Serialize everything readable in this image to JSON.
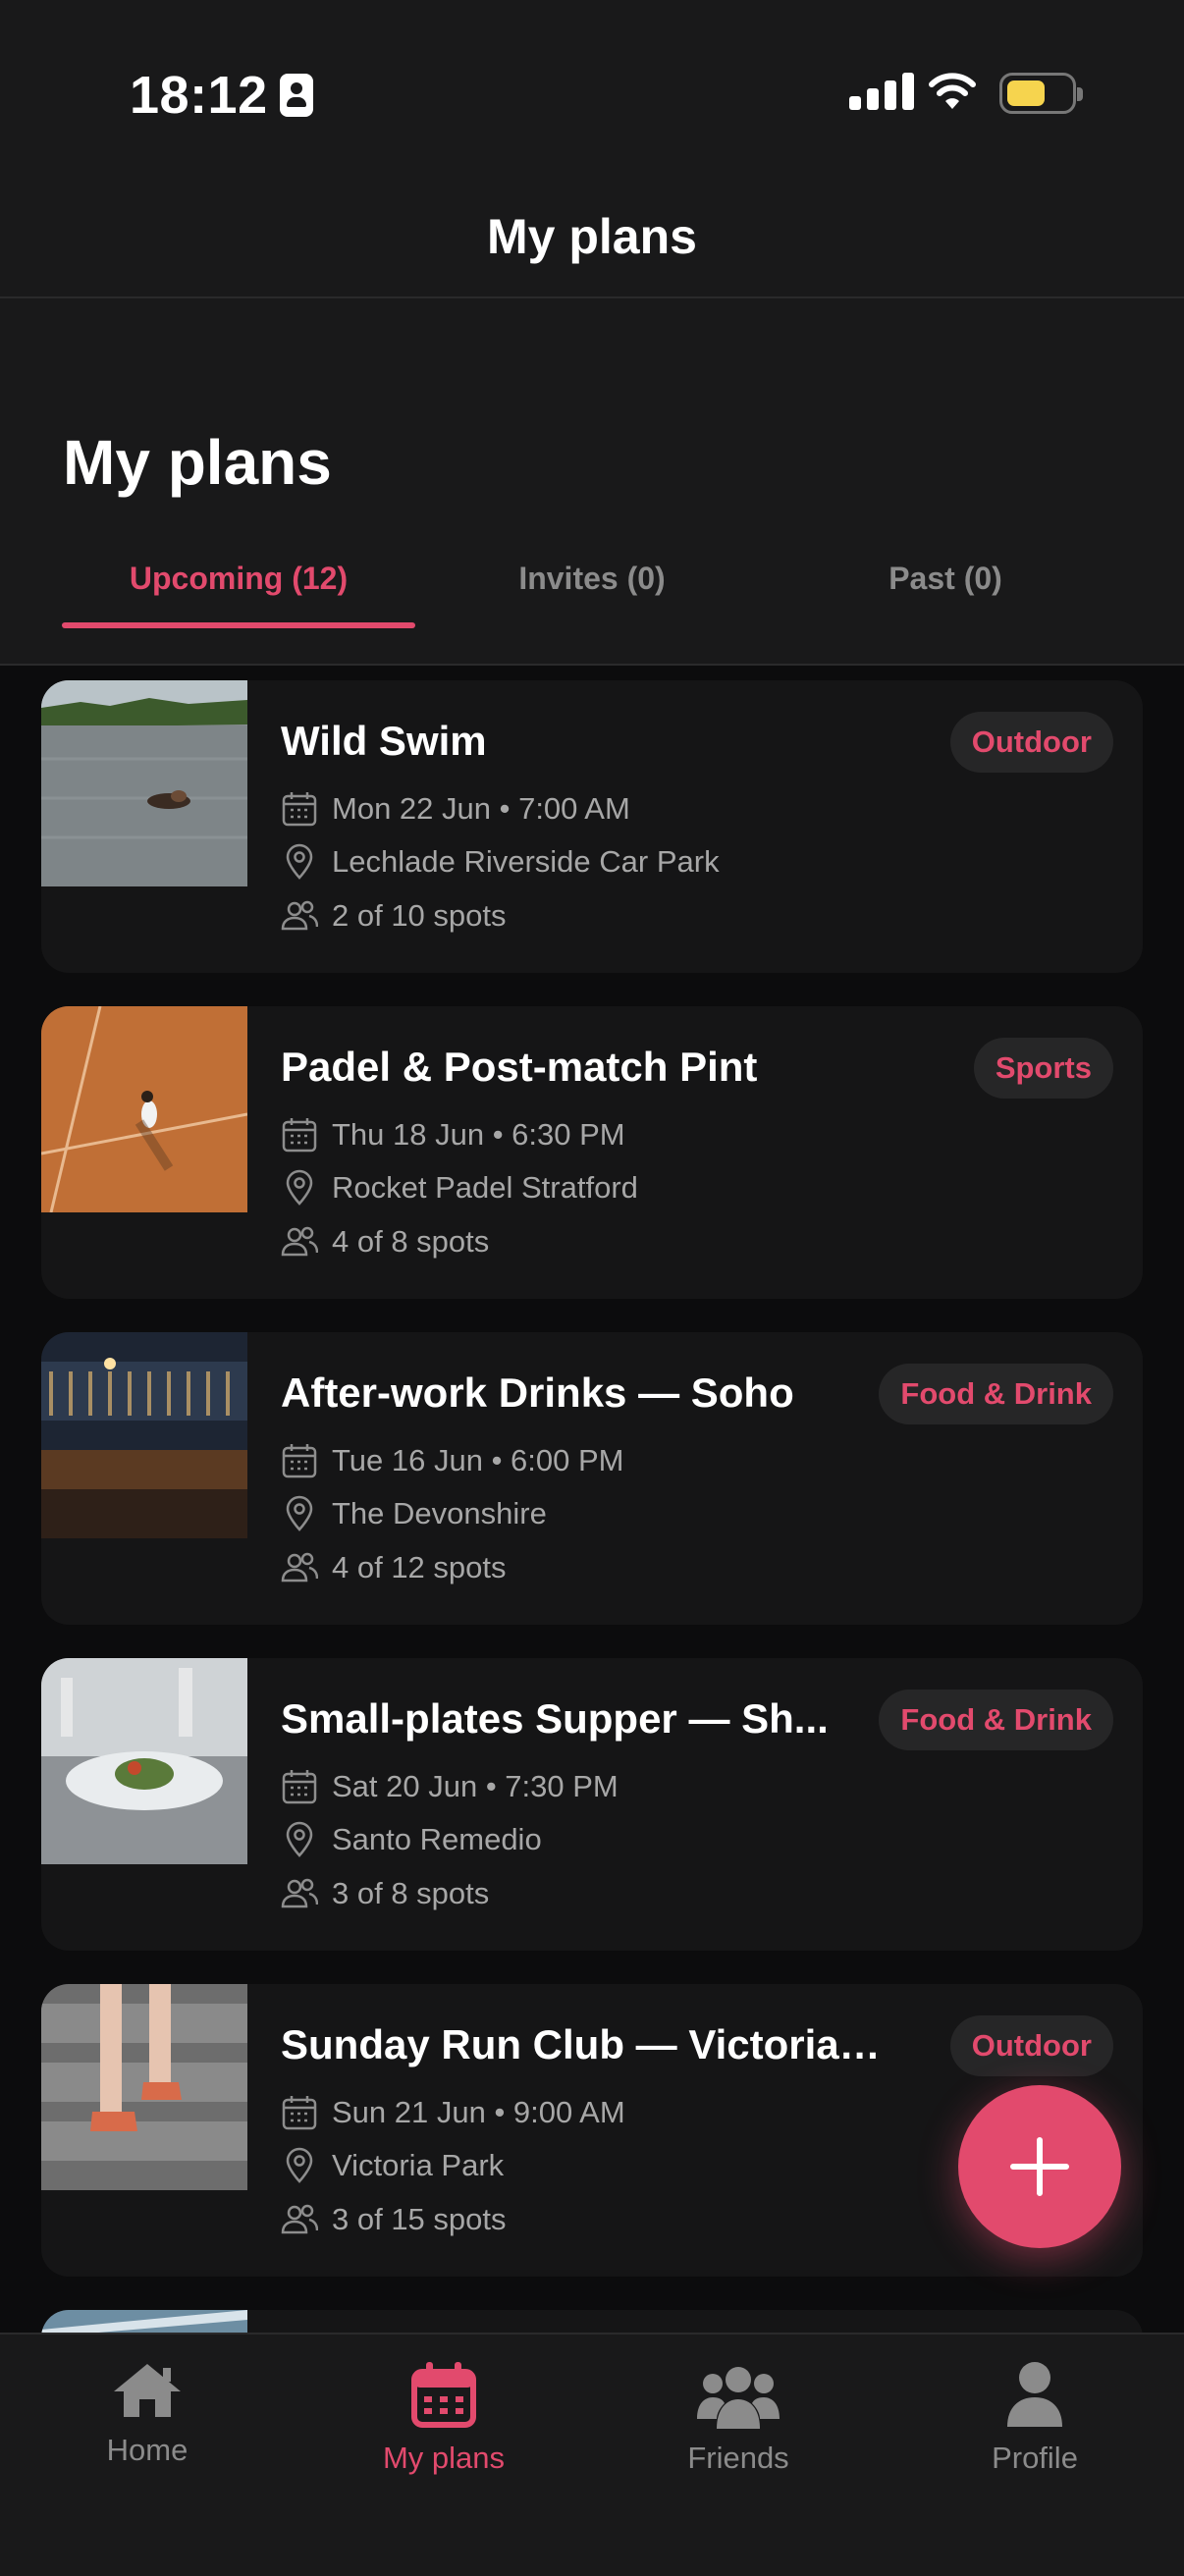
{
  "status_bar": {
    "time": "18:12"
  },
  "header": {
    "nav_title": "My plans",
    "large_title": "My plans"
  },
  "tabs": [
    {
      "label": "Upcoming (12)",
      "active": true
    },
    {
      "label": "Invites (0)",
      "active": false
    },
    {
      "label": "Past (0)",
      "active": false
    }
  ],
  "plans": [
    {
      "title": "Wild Swim",
      "category": "Outdoor",
      "date": "Mon 22 Jun • 7:00 AM",
      "location": "Lechlade Riverside Car Park",
      "spots": "2 of 10 spots"
    },
    {
      "title": "Padel & Post-match Pint",
      "category": "Sports",
      "date": "Thu 18 Jun • 6:30 PM",
      "location": "Rocket Padel Stratford",
      "spots": "4 of 8 spots"
    },
    {
      "title": "After-work Drinks — Soho",
      "category": "Food & Drink",
      "date": "Tue 16 Jun • 6:00 PM",
      "location": "The Devonshire",
      "spots": "4 of 12 spots"
    },
    {
      "title": "Small-plates Supper — Sh...",
      "category": "Food & Drink",
      "date": "Sat 20 Jun • 7:30 PM",
      "location": "Santo Remedio",
      "spots": "3 of 8 spots"
    },
    {
      "title": "Sunday Run Club — Victoria P...",
      "category": "Outdoor",
      "date": "Sun 21 Jun • 9:00 AM",
      "location": "Victoria Park",
      "spots": "3 of 15 spots"
    }
  ],
  "bottom_nav": [
    {
      "label": "Home",
      "icon": "home-icon",
      "active": false
    },
    {
      "label": "My plans",
      "icon": "calendar-icon",
      "active": true
    },
    {
      "label": "Friends",
      "icon": "friends-icon",
      "active": false
    },
    {
      "label": "Profile",
      "icon": "profile-icon",
      "active": false
    }
  ],
  "fab": {
    "icon": "plus-icon"
  },
  "colors": {
    "accent": "#e24a6d",
    "background": "#0c0c0d",
    "card": "#151516",
    "chip": "#262627"
  }
}
